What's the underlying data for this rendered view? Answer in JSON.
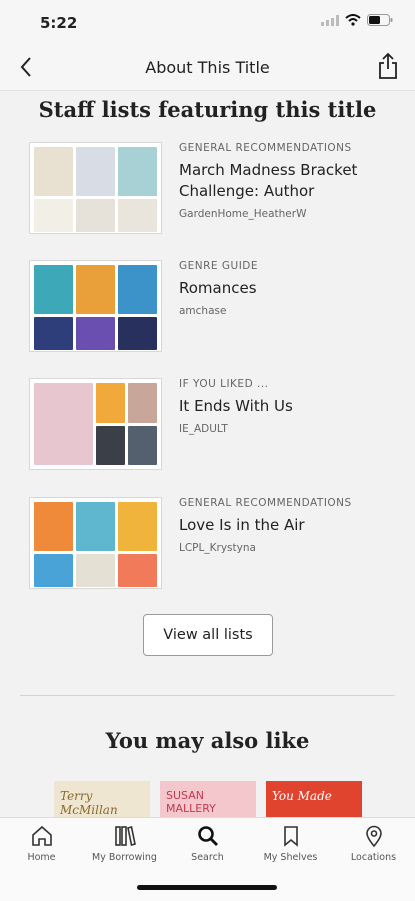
{
  "status": {
    "time": "5:22"
  },
  "header": {
    "title": "About This Title"
  },
  "staff_lists": {
    "heading": "Staff lists featuring this title",
    "items": [
      {
        "category": "GENERAL RECOMMENDATIONS",
        "name": "March Madness Bracket Challenge: Author",
        "owner": "GardenHome_HeatherW"
      },
      {
        "category": "GENRE GUIDE",
        "name": "Romances",
        "owner": "amchase"
      },
      {
        "category": "IF YOU LIKED ...",
        "name": "It Ends With Us",
        "owner": "IE_ADULT"
      },
      {
        "category": "GENERAL RECOMMENDATIONS",
        "name": "Love Is in the Air",
        "owner": "LCPL_Krystyna"
      }
    ],
    "view_all_label": "View all lists"
  },
  "also_like": {
    "heading": "You may also like",
    "covers": [
      {
        "text": "Terry McMillan"
      },
      {
        "text": "SUSAN MALLERY"
      },
      {
        "text": "You Made"
      }
    ]
  },
  "tabs": [
    {
      "label": "Home",
      "icon": "home-icon"
    },
    {
      "label": "My Borrowing",
      "icon": "books-icon"
    },
    {
      "label": "Search",
      "icon": "search-icon"
    },
    {
      "label": "My Shelves",
      "icon": "bookmark-icon"
    },
    {
      "label": "Locations",
      "icon": "location-pin-icon"
    }
  ]
}
